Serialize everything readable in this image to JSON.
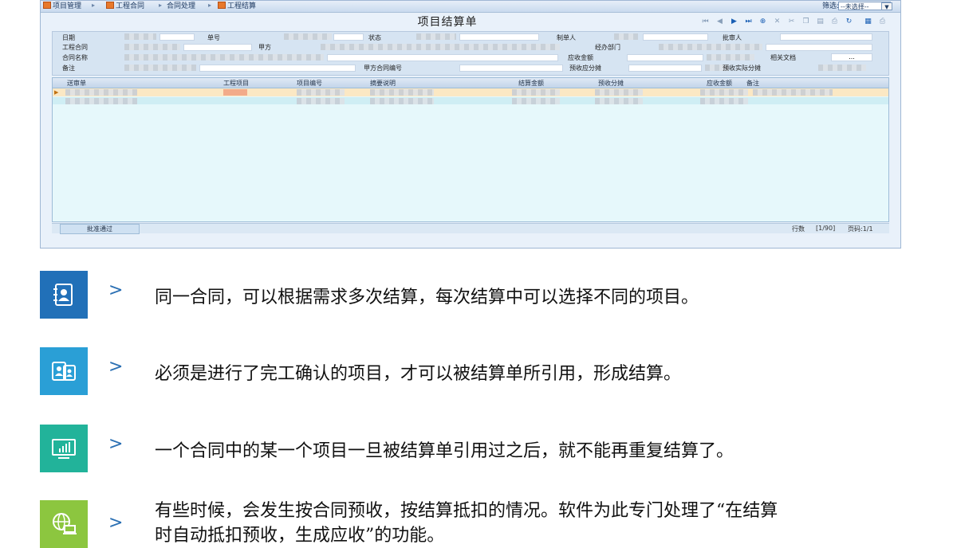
{
  "breadcrumb": [
    "项目管理",
    "工程合同",
    "合同处理",
    "工程结算"
  ],
  "filter": {
    "label": "筛选:",
    "value": "--未选择--"
  },
  "form": {
    "title": "项目结算单",
    "labels": {
      "date": "日期",
      "number": "单号",
      "status": "状态",
      "creator": "制单人",
      "approver": "批审人",
      "contract": "工程合同",
      "party_a": "甲方",
      "department": "经办部门",
      "contract_name": "合同名称",
      "receivable_amount": "应收金额",
      "related_docs": "相关文档",
      "remark": "备注",
      "party_a_contract_no": "甲方合同编号",
      "prepaid_allocation": "预收应分摊",
      "prepaid_actual_allocation": "预收实际分摊"
    },
    "related_docs_button": "..."
  },
  "grid": {
    "columns": [
      "送审单",
      "工程项目",
      "项目编号",
      "摘要说明",
      "结算金额",
      "预收分摊",
      "应收金额",
      "备注"
    ]
  },
  "statusbar": {
    "approved": "批准通过",
    "row_count_label": "行数",
    "row_count": "[1/90]",
    "page": "页码:1/1"
  },
  "features": [
    {
      "icon": "contacts-book-icon",
      "color": "#2170b8",
      "lines": [
        "同一合同，可以根据需求多次结算，每次结算中可以选择不同的项目。"
      ]
    },
    {
      "icon": "tablet-users-icon",
      "color": "#2a9fd6",
      "lines": [
        "必须是进行了完工确认的项目，才可以被结算单所引用，形成结算。"
      ]
    },
    {
      "icon": "monitor-chart-icon",
      "color": "#22b39a",
      "lines": [
        "一个合同中的某一个项目一旦被结算单引用过之后，就不能再重复结算了。"
      ]
    },
    {
      "icon": "globe-laptop-icon",
      "color": "#8cc63f",
      "lines": [
        "有些时候，会发生按合同预收，按结算抵扣的情况。软件为此专门处理了“在结算",
        "时自动抵扣预收，生成应收”的功能。"
      ]
    }
  ]
}
